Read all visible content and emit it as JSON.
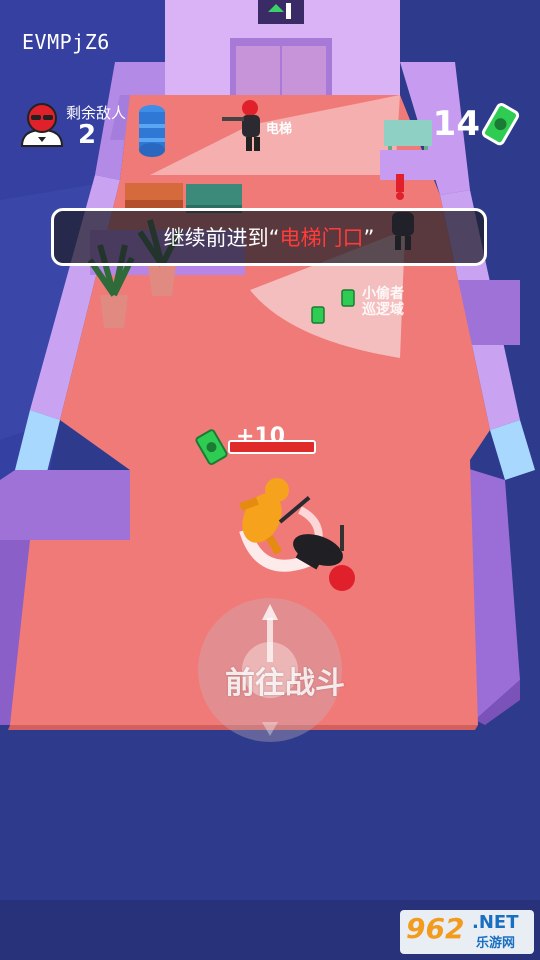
{
  "hud": {
    "player_id": "EVMPjZ6",
    "enemies_label": "剩余敌人",
    "enemies_count": "2",
    "cash_count": "14"
  },
  "objective": {
    "prefix": "继续前进到“",
    "highlight": "电梯门口",
    "suffix": "”"
  },
  "reward": {
    "plus": "+10",
    "hp_fraction": 1.0
  },
  "floor_labels": {
    "elevator": "电梯",
    "patrol_line1": "小偷者",
    "patrol_line2": "巡逻域"
  },
  "controls": {
    "go_fight": "前往战斗"
  },
  "branding": {
    "logo_num": "962",
    "logo_net": ".NET",
    "logo_sub": "乐游网"
  },
  "colors": {
    "floor": "#f07a78",
    "walls": "#c79cf0",
    "enemy_red": "#e0202a",
    "player_orange": "#f6a21c",
    "cash_green": "#2ecc52"
  }
}
